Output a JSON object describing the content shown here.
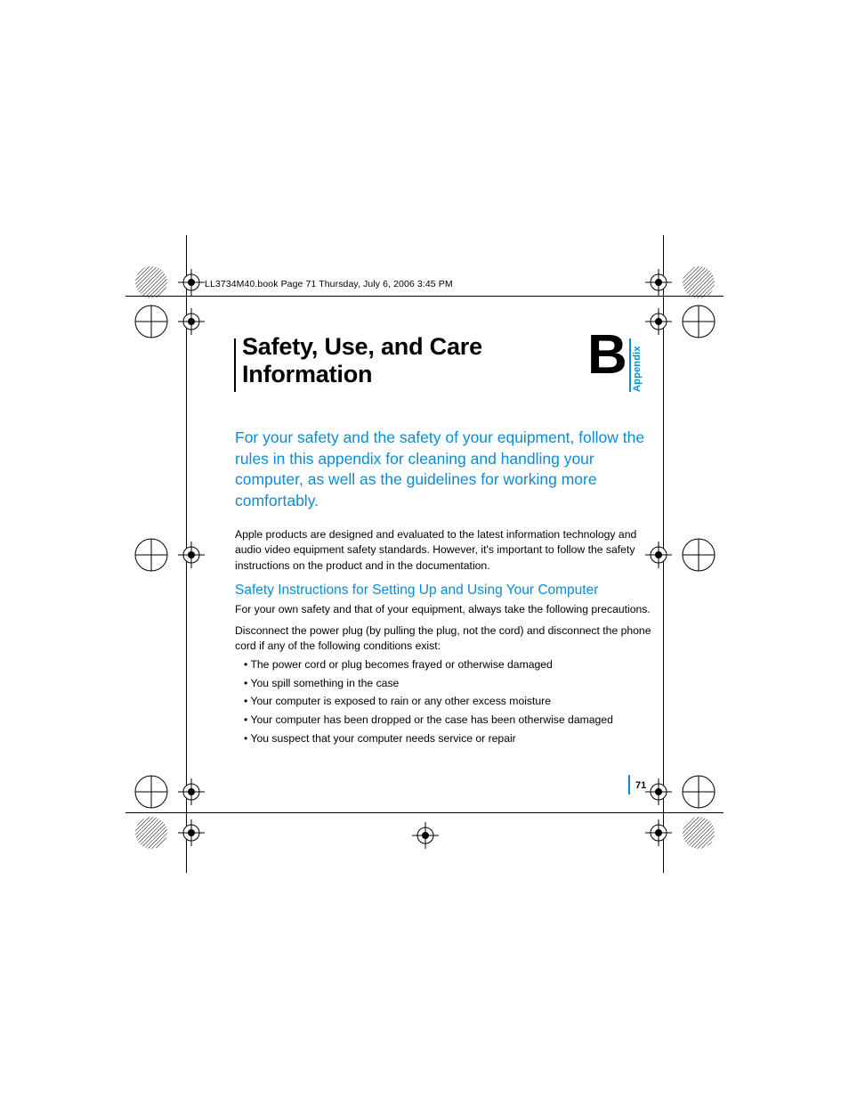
{
  "running_head": "LL3734M40.book  Page 71  Thursday, July 6, 2006  3:45 PM",
  "title": "Safety, Use, and Care Information",
  "appendix_letter": "B",
  "appendix_word": "Appendix",
  "intro": "For your safety and the safety of your equipment, follow the rules in this appendix for cleaning and handling your computer, as well as the guidelines for working more comfortably.",
  "body1": "Apple products are designed and evaluated to the latest information technology and audio video equipment safety standards. However, it's important to follow the safety instructions on the product and in the documentation.",
  "section_heading": "Safety Instructions for Setting Up and Using Your Computer",
  "body2": "For your own safety and that of your equipment, always take the following precautions.",
  "body3": "Disconnect the power plug (by pulling the plug, not the cord) and disconnect the phone cord if any of the following conditions exist:",
  "bullets": [
    "The power cord or plug becomes frayed or otherwise damaged",
    "You spill something in the case",
    "Your computer is exposed to rain or any other excess moisture",
    "Your computer has been dropped or the case has been otherwise damaged",
    "You suspect that your computer needs service or repair"
  ],
  "page_number": "71"
}
